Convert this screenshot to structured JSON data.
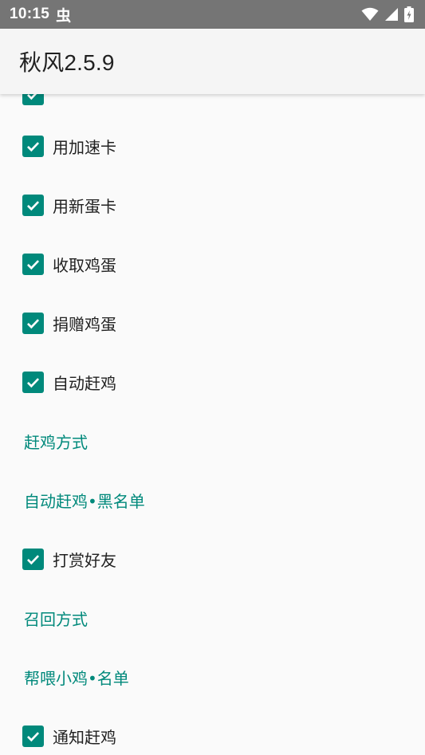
{
  "status_bar": {
    "time": "10:15",
    "notification_glyph": "虫",
    "icons": [
      "wifi-icon",
      "signal-icon",
      "battery-charging-icon"
    ]
  },
  "app_bar": {
    "title": "秋风2.5.9"
  },
  "colors": {
    "accent": "#00897b",
    "status_bar": "#757575",
    "app_bar": "#f5f5f5",
    "background": "#fafafa",
    "text": "#212121"
  },
  "list": {
    "items": [
      {
        "type": "checkbox",
        "label": "",
        "checked": true
      },
      {
        "type": "checkbox",
        "label": "用加速卡",
        "checked": true
      },
      {
        "type": "checkbox",
        "label": "用新蛋卡",
        "checked": true
      },
      {
        "type": "checkbox",
        "label": "收取鸡蛋",
        "checked": true
      },
      {
        "type": "checkbox",
        "label": "捐赠鸡蛋",
        "checked": true
      },
      {
        "type": "checkbox",
        "label": "自动赶鸡",
        "checked": true
      },
      {
        "type": "link",
        "label": "赶鸡方式"
      },
      {
        "type": "link",
        "label": "自动赶鸡•黑名单"
      },
      {
        "type": "checkbox",
        "label": "打赏好友",
        "checked": true
      },
      {
        "type": "link",
        "label": "召回方式"
      },
      {
        "type": "link",
        "label": "帮喂小鸡•名单"
      },
      {
        "type": "checkbox",
        "label": "通知赶鸡",
        "checked": true
      }
    ]
  }
}
